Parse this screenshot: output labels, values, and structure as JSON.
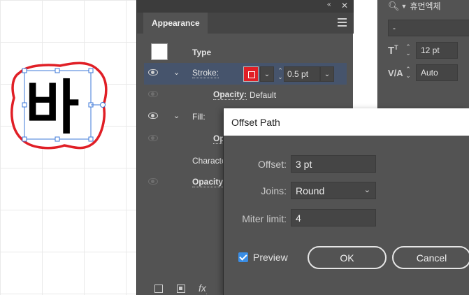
{
  "canvas": {
    "glyph": "바",
    "offset_stroke_color": "#e01f26",
    "selection_color": "#3e78d8"
  },
  "character_panel": {
    "font_name": "휴먼엑체",
    "font_style": "-",
    "font_size": "12 pt",
    "tracking": "Auto",
    "font_size_icon": "font-size-icon",
    "tracking_icon": "tracking-icon"
  },
  "appearance": {
    "tab_label": "Appearance",
    "header_label": "Type",
    "stroke_label": "Stroke:",
    "stroke_color": "#e01f26",
    "stroke_weight": "0.5 pt",
    "stroke_opacity_label": "Opacity:",
    "stroke_opacity_value": "Default",
    "fill_label": "Fill:",
    "fill_opacity_label": "Op",
    "characters_label": "Characte",
    "opacity_label": "Opacity:"
  },
  "dialog": {
    "title": "Offset Path",
    "offset_label": "Offset:",
    "offset_value": "3 pt",
    "joins_label": "Joins:",
    "joins_value": "Round",
    "miter_label": "Miter limit:",
    "miter_value": "4",
    "preview_label": "Preview",
    "preview_checked": true,
    "ok_label": "OK",
    "cancel_label": "Cancel",
    "accent_color": "#3a8ee6"
  }
}
